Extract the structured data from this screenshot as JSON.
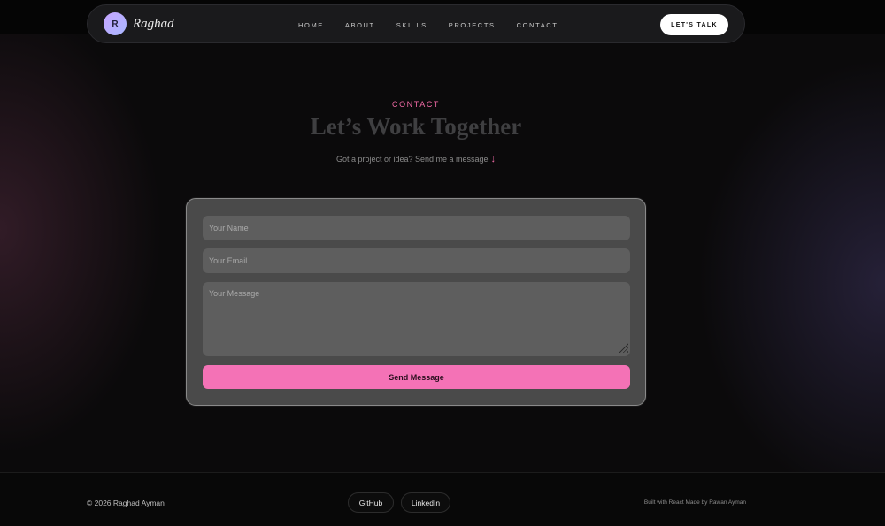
{
  "nav": {
    "avatar_initial": "R",
    "brand": "Raghad",
    "links": [
      "HOME",
      "ABOUT",
      "SKILLS",
      "PROJECTS",
      "CONTACT"
    ],
    "cta": "LET'S TALK"
  },
  "hero": {
    "eyebrow": "CONTACT",
    "title": "Let’s Work Together",
    "subtitle": "Got a project or idea? Send me a message",
    "arrow": "↓"
  },
  "form": {
    "name_placeholder": "Your Name",
    "email_placeholder": "Your Email",
    "message_placeholder": "Your Message",
    "submit_label": "Send Message"
  },
  "footer": {
    "copyright": "© 2026 Raghad Ayman",
    "github": "GitHub",
    "linkedin": "LinkedIn",
    "built_with": "Built with React Made by Rawan Ayman"
  },
  "colors": {
    "accent": "#f472b6",
    "background": "#0b0a0b"
  }
}
